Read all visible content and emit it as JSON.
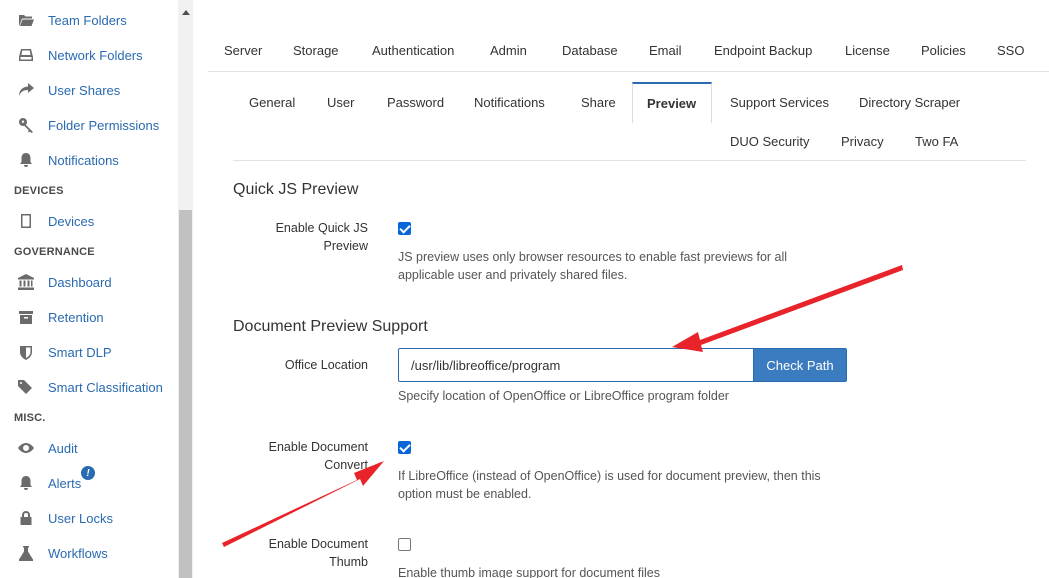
{
  "sidebar": {
    "items": [
      {
        "label": "Team Folders",
        "icon": "folder-open-icon"
      },
      {
        "label": "Network Folders",
        "icon": "hdd-icon"
      },
      {
        "label": "User Shares",
        "icon": "share-icon"
      },
      {
        "label": "Folder Permissions",
        "icon": "key-icon"
      },
      {
        "label": "Notifications",
        "icon": "bell-icon"
      },
      {
        "label": "Devices",
        "icon": "tablet-icon"
      },
      {
        "label": "Dashboard",
        "icon": "bank-icon"
      },
      {
        "label": "Retention",
        "icon": "archive-icon"
      },
      {
        "label": "Smart DLP",
        "icon": "shield-icon"
      },
      {
        "label": "Smart Classification",
        "icon": "tags-icon"
      },
      {
        "label": "Audit",
        "icon": "eye-icon"
      },
      {
        "label": "Alerts",
        "icon": "bell-icon",
        "badge": "!"
      },
      {
        "label": "User Locks",
        "icon": "lock-icon"
      },
      {
        "label": "Workflows",
        "icon": "flask-icon"
      }
    ],
    "sections": {
      "devices": "DEVICES",
      "governance": "GOVERNANCE",
      "misc": "MISC."
    }
  },
  "top_tabs": [
    "Server",
    "Storage",
    "Authentication",
    "Admin",
    "Database",
    "Email",
    "Endpoint Backup",
    "License",
    "Policies",
    "SSO"
  ],
  "sub_tabs": [
    "General",
    "User",
    "Password",
    "Notifications",
    "Share",
    "Preview",
    "Support Services",
    "Directory Scraper",
    "DUO Security",
    "Privacy",
    "Two FA"
  ],
  "active_sub_tab": "Preview",
  "quick_js": {
    "title": "Quick JS Preview",
    "label_line1": "Enable Quick JS",
    "label_line2": "Preview",
    "checked": true,
    "help_line1": "JS preview uses only browser resources to enable fast previews for all",
    "help_line2": "applicable user and privately shared files."
  },
  "doc_preview": {
    "title": "Document Preview Support",
    "office_label": "Office Location",
    "office_value": "/usr/lib/libreoffice/program",
    "check_path_label": "Check Path",
    "office_help": "Specify location of OpenOffice or LibreOffice program folder",
    "convert_label_line1": "Enable Document",
    "convert_label_line2": "Convert",
    "convert_checked": true,
    "convert_help_line1": "If LibreOffice (instead of OpenOffice) is used for document preview, then this",
    "convert_help_line2": "option must be enabled.",
    "thumb_label_line1": "Enable Document",
    "thumb_label_line2": "Thumb",
    "thumb_checked": false,
    "thumb_help": "Enable thumb image support for document files"
  },
  "colors": {
    "link": "#2a6ab0",
    "button": "#3b7bbf",
    "arrow": "#e8232a"
  }
}
